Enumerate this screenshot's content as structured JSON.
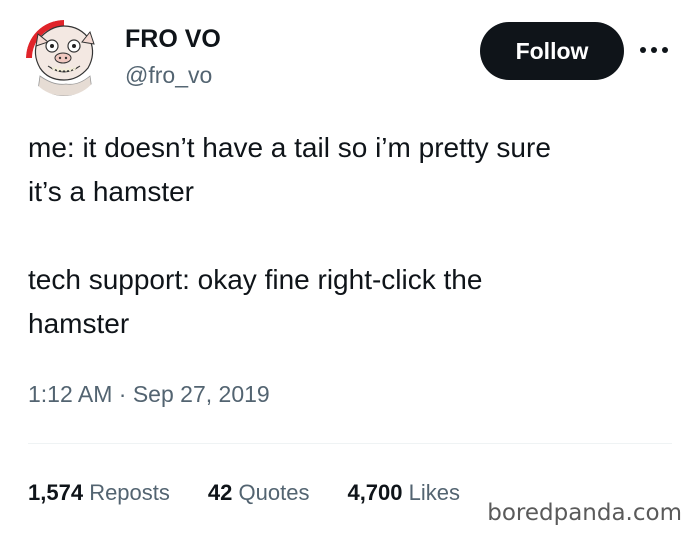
{
  "author": {
    "display_name": "FRO VO",
    "handle": "@fro_vo",
    "avatar_icon": "cartoon-pig-avatar"
  },
  "actions": {
    "follow_label": "Follow",
    "more_icon": "more-horizontal-icon"
  },
  "tweet": {
    "paragraphs": [
      {
        "lines": [
          "me: it doesn’t have a tail so i’m pretty sure",
          "it’s a hamster"
        ]
      },
      {
        "lines": [
          "tech support: okay fine right-click the",
          "hamster"
        ]
      }
    ],
    "time": "1:12 AM",
    "separator": "·",
    "date": "Sep 27, 2019"
  },
  "stats": [
    {
      "value": "1,574",
      "label": "Reposts"
    },
    {
      "value": "42",
      "label": "Quotes"
    },
    {
      "value": "4,700",
      "label": "Likes"
    }
  ],
  "watermark": "boredpanda.com",
  "colors": {
    "text": "#0f1419",
    "secondary": "#536471",
    "follow_bg": "#0f1419",
    "follow_text": "#ffffff",
    "divider": "#eff3f4"
  }
}
